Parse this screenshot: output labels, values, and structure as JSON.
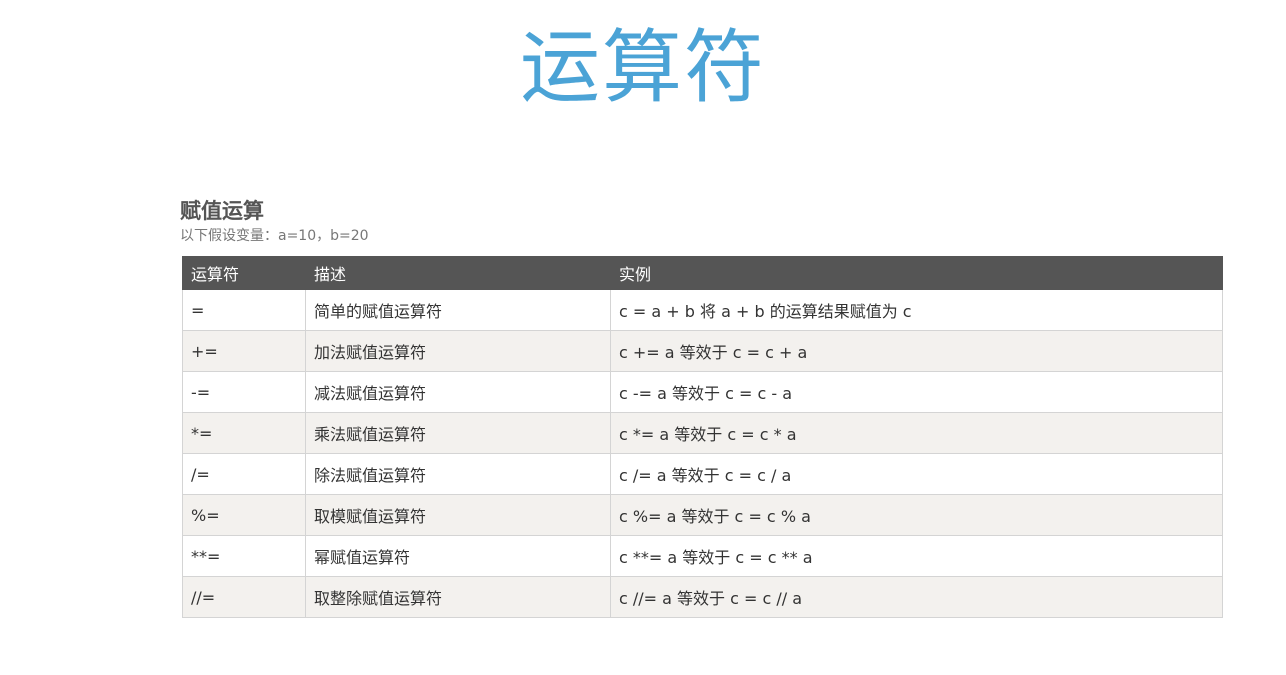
{
  "page": {
    "title": "运算符",
    "title_color": "#4ba3d6"
  },
  "section": {
    "heading": "赋值运算",
    "note": "以下假设变量：a=10，b=20"
  },
  "table": {
    "header_bg": "#555555",
    "alt_row_bg": "#f3f1ee",
    "headers": [
      "运算符",
      "描述",
      "实例"
    ],
    "rows": [
      {
        "op": "=",
        "desc": "简单的赋值运算符",
        "example": "c = a + b 将 a + b 的运算结果赋值为 c"
      },
      {
        "op": "+=",
        "desc": "加法赋值运算符",
        "example": "c += a 等效于 c = c + a"
      },
      {
        "op": "-=",
        "desc": "减法赋值运算符",
        "example": "c -= a 等效于 c = c - a"
      },
      {
        "op": "*=",
        "desc": "乘法赋值运算符",
        "example": "c *= a 等效于 c = c * a"
      },
      {
        "op": "/=",
        "desc": "除法赋值运算符",
        "example": "c /= a 等效于 c = c / a"
      },
      {
        "op": "%=",
        "desc": "取模赋值运算符",
        "example": "c %= a 等效于 c = c % a"
      },
      {
        "op": "**=",
        "desc": "幂赋值运算符",
        "example": "c **= a 等效于 c = c ** a"
      },
      {
        "op": "//=",
        "desc": "取整除赋值运算符",
        "example": "c //= a 等效于 c = c // a"
      }
    ]
  }
}
